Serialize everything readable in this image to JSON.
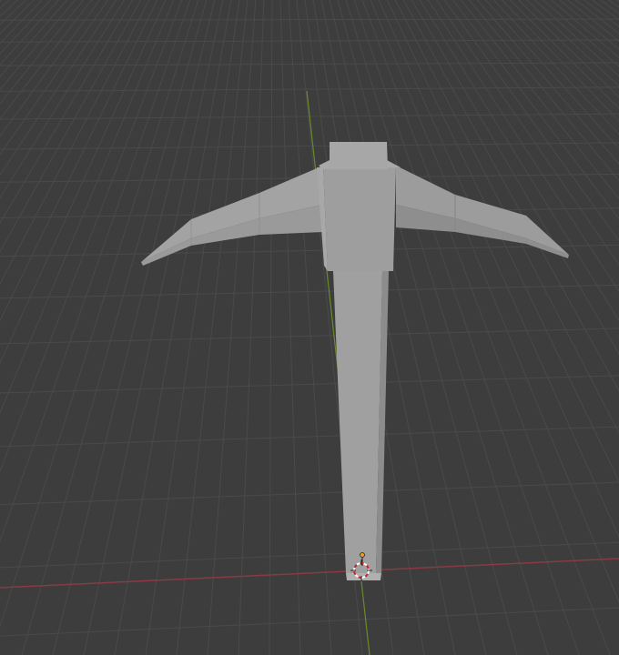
{
  "viewport": {
    "kind": "3d-viewport",
    "object": "pickaxe-mesh",
    "colors": {
      "background": "#3d3d3d",
      "grid": "#4a4a4a",
      "x_axis": "#8a3a44",
      "y_axis": "#6a8a2a",
      "mesh_light": "#a6a6a6",
      "mesh_mid": "#9a9a9a",
      "mesh_dark": "#8a8a8a",
      "origin": "#e8a020"
    }
  }
}
